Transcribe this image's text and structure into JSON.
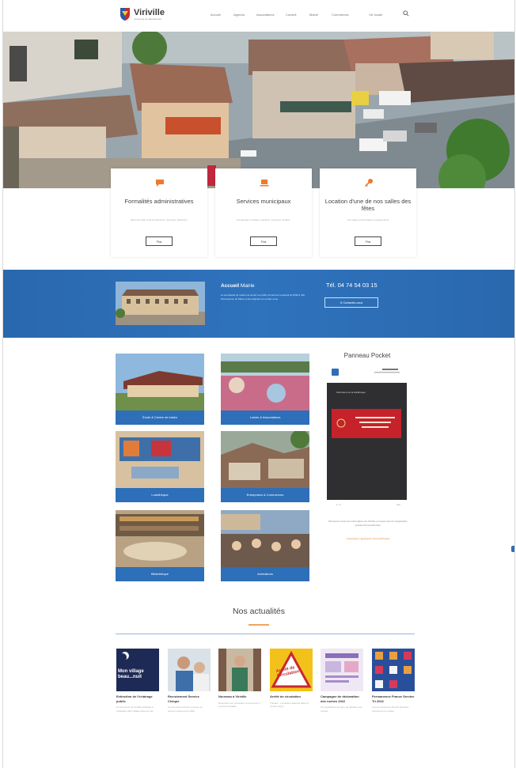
{
  "header": {
    "logo_name": "Viriville",
    "logo_sub": "commune du département",
    "nav": [
      "Accueil",
      "Agenda",
      "Associations",
      "Conseil",
      "Mairie",
      "Commerces",
      "Vie locale"
    ]
  },
  "cards": [
    {
      "title": "Formalités administratives",
      "desc": "État civil, Plan local d'urbanisme, Cimetière, Élections",
      "button": "Plus"
    },
    {
      "title": "Services municipaux",
      "desc": "Restauration scolaire, Garderie, Transport scolaire",
      "button": "Plus"
    },
    {
      "title": "Location d'une de nos salles des fêtes",
      "desc": "Les salles communales et équipements",
      "button": "Plus"
    }
  ],
  "accueil": {
    "title_bold": "Accueil",
    "title_rest": " Mairie",
    "desc": "Le secrétariat de mairie est ouvert au public du lundi au vendredi de 8h30 à 12h. Permanence du Maire et des adjoints sur rendez-vous.",
    "phone": "Tél. 04 74 54 03 15",
    "contact_button": "Contactez-nous"
  },
  "tiles": [
    "École & Centre de loisirs",
    "Loisirs & Associations",
    "Ludothèque",
    "Entreprises & Commerces",
    "Bibliothèque",
    "Animations"
  ],
  "panneau": {
    "title": "Panneau Pocket",
    "screen_title": "Fermeture de la ludothèque",
    "footer_left": "1 / 2",
    "footer_right": "Voir",
    "desc": "Retrouvez toutes les informations de Viriville en temps réel sur l'application gratuite PanneauPocket.",
    "link": "Télécharger l'application PanneauPocket"
  },
  "news": {
    "heading": "Nos actualités",
    "items": [
      {
        "title": "Extinction de l'éclairage public",
        "desc": "La commune de Viriville participe à l'opération Mon village beau la nuit.",
        "thumb_text": "Mon village beau...nuit"
      },
      {
        "title": "Recrutement Service Civique",
        "desc": "La commune recrute un jeune en service civique pour 2022."
      },
      {
        "title": "Nouveau à Viriville",
        "desc": "Découvrez les nouveaux commerces et services installés."
      },
      {
        "title": "Arrêté de circulation",
        "desc": "Travaux : circulation alternée dans le centre bourg.",
        "thumb_text": "Arrêté de Circulation"
      },
      {
        "title": "Campagne de déclaration des ruches 2022",
        "desc": "Tout apiculteur est tenu de déclarer ses ruches."
      },
      {
        "title": "Permanence France Service Tri 2022",
        "desc": "Les permanences France Services reprennent en mairie."
      }
    ]
  },
  "colors": {
    "brand_blue": "#2d6fb8",
    "accent_orange": "#ee7a2f",
    "accent_red": "#c0283d"
  }
}
